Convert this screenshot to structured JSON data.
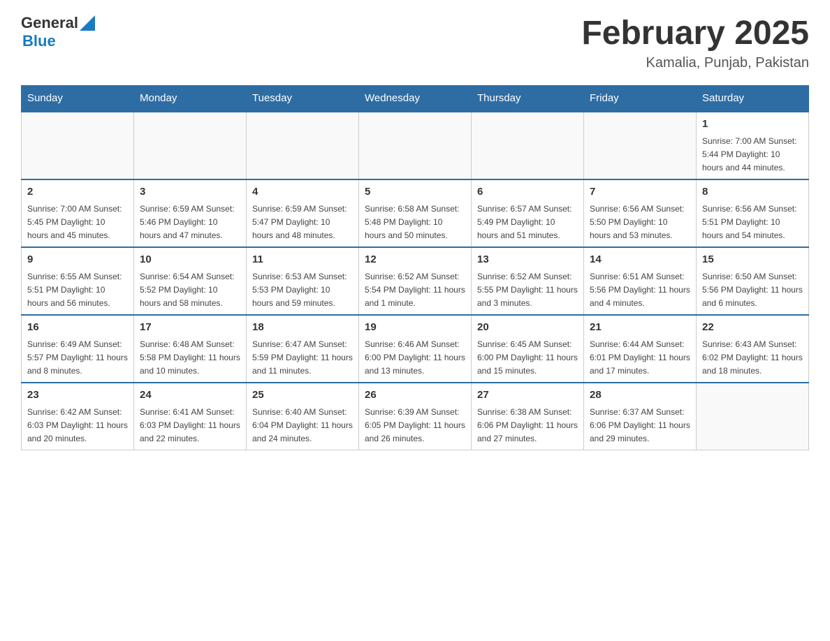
{
  "header": {
    "logo_general": "General",
    "logo_blue": "Blue",
    "month_title": "February 2025",
    "location": "Kamalia, Punjab, Pakistan"
  },
  "days_of_week": [
    "Sunday",
    "Monday",
    "Tuesday",
    "Wednesday",
    "Thursday",
    "Friday",
    "Saturday"
  ],
  "weeks": [
    [
      {
        "day": "",
        "info": ""
      },
      {
        "day": "",
        "info": ""
      },
      {
        "day": "",
        "info": ""
      },
      {
        "day": "",
        "info": ""
      },
      {
        "day": "",
        "info": ""
      },
      {
        "day": "",
        "info": ""
      },
      {
        "day": "1",
        "info": "Sunrise: 7:00 AM\nSunset: 5:44 PM\nDaylight: 10 hours and 44 minutes."
      }
    ],
    [
      {
        "day": "2",
        "info": "Sunrise: 7:00 AM\nSunset: 5:45 PM\nDaylight: 10 hours and 45 minutes."
      },
      {
        "day": "3",
        "info": "Sunrise: 6:59 AM\nSunset: 5:46 PM\nDaylight: 10 hours and 47 minutes."
      },
      {
        "day": "4",
        "info": "Sunrise: 6:59 AM\nSunset: 5:47 PM\nDaylight: 10 hours and 48 minutes."
      },
      {
        "day": "5",
        "info": "Sunrise: 6:58 AM\nSunset: 5:48 PM\nDaylight: 10 hours and 50 minutes."
      },
      {
        "day": "6",
        "info": "Sunrise: 6:57 AM\nSunset: 5:49 PM\nDaylight: 10 hours and 51 minutes."
      },
      {
        "day": "7",
        "info": "Sunrise: 6:56 AM\nSunset: 5:50 PM\nDaylight: 10 hours and 53 minutes."
      },
      {
        "day": "8",
        "info": "Sunrise: 6:56 AM\nSunset: 5:51 PM\nDaylight: 10 hours and 54 minutes."
      }
    ],
    [
      {
        "day": "9",
        "info": "Sunrise: 6:55 AM\nSunset: 5:51 PM\nDaylight: 10 hours and 56 minutes."
      },
      {
        "day": "10",
        "info": "Sunrise: 6:54 AM\nSunset: 5:52 PM\nDaylight: 10 hours and 58 minutes."
      },
      {
        "day": "11",
        "info": "Sunrise: 6:53 AM\nSunset: 5:53 PM\nDaylight: 10 hours and 59 minutes."
      },
      {
        "day": "12",
        "info": "Sunrise: 6:52 AM\nSunset: 5:54 PM\nDaylight: 11 hours and 1 minute."
      },
      {
        "day": "13",
        "info": "Sunrise: 6:52 AM\nSunset: 5:55 PM\nDaylight: 11 hours and 3 minutes."
      },
      {
        "day": "14",
        "info": "Sunrise: 6:51 AM\nSunset: 5:56 PM\nDaylight: 11 hours and 4 minutes."
      },
      {
        "day": "15",
        "info": "Sunrise: 6:50 AM\nSunset: 5:56 PM\nDaylight: 11 hours and 6 minutes."
      }
    ],
    [
      {
        "day": "16",
        "info": "Sunrise: 6:49 AM\nSunset: 5:57 PM\nDaylight: 11 hours and 8 minutes."
      },
      {
        "day": "17",
        "info": "Sunrise: 6:48 AM\nSunset: 5:58 PM\nDaylight: 11 hours and 10 minutes."
      },
      {
        "day": "18",
        "info": "Sunrise: 6:47 AM\nSunset: 5:59 PM\nDaylight: 11 hours and 11 minutes."
      },
      {
        "day": "19",
        "info": "Sunrise: 6:46 AM\nSunset: 6:00 PM\nDaylight: 11 hours and 13 minutes."
      },
      {
        "day": "20",
        "info": "Sunrise: 6:45 AM\nSunset: 6:00 PM\nDaylight: 11 hours and 15 minutes."
      },
      {
        "day": "21",
        "info": "Sunrise: 6:44 AM\nSunset: 6:01 PM\nDaylight: 11 hours and 17 minutes."
      },
      {
        "day": "22",
        "info": "Sunrise: 6:43 AM\nSunset: 6:02 PM\nDaylight: 11 hours and 18 minutes."
      }
    ],
    [
      {
        "day": "23",
        "info": "Sunrise: 6:42 AM\nSunset: 6:03 PM\nDaylight: 11 hours and 20 minutes."
      },
      {
        "day": "24",
        "info": "Sunrise: 6:41 AM\nSunset: 6:03 PM\nDaylight: 11 hours and 22 minutes."
      },
      {
        "day": "25",
        "info": "Sunrise: 6:40 AM\nSunset: 6:04 PM\nDaylight: 11 hours and 24 minutes."
      },
      {
        "day": "26",
        "info": "Sunrise: 6:39 AM\nSunset: 6:05 PM\nDaylight: 11 hours and 26 minutes."
      },
      {
        "day": "27",
        "info": "Sunrise: 6:38 AM\nSunset: 6:06 PM\nDaylight: 11 hours and 27 minutes."
      },
      {
        "day": "28",
        "info": "Sunrise: 6:37 AM\nSunset: 6:06 PM\nDaylight: 11 hours and 29 minutes."
      },
      {
        "day": "",
        "info": ""
      }
    ]
  ]
}
